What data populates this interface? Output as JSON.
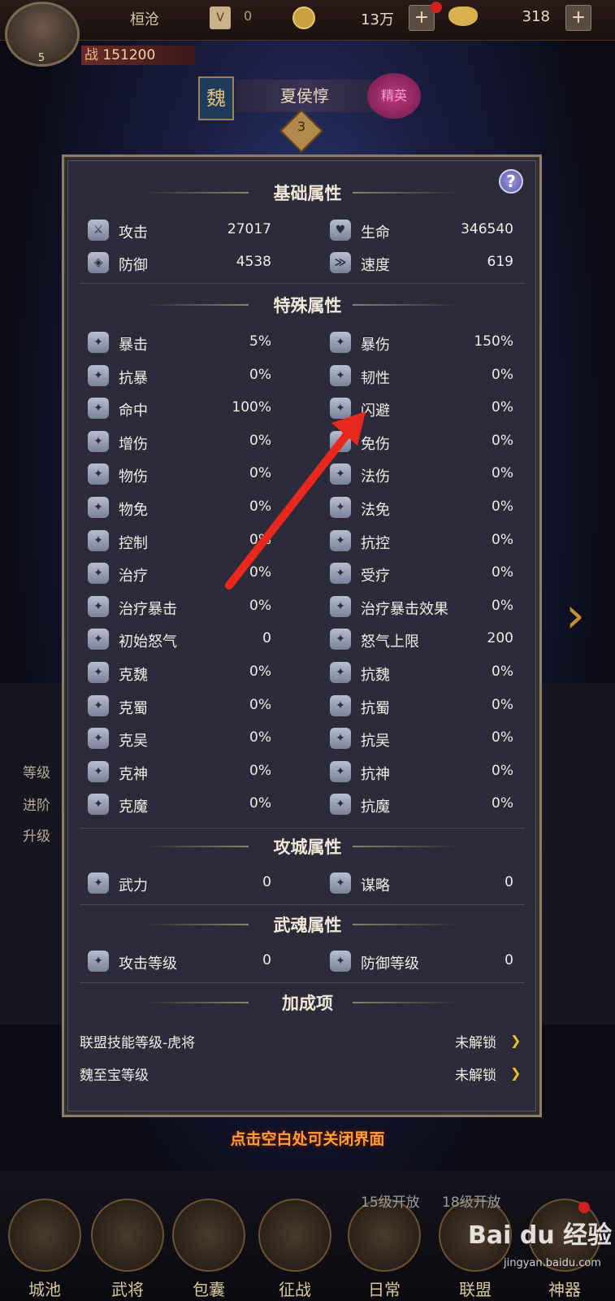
{
  "topbar": {
    "player_name": "桓沧",
    "vip_label": "V",
    "vip_value": "0",
    "coins": "13万",
    "ingots": "318",
    "plus": "+",
    "avatar_level": "5",
    "power_prefix": "战",
    "power": "151200"
  },
  "hero": {
    "faction": "魏",
    "name": "夏侯惇",
    "badge": "精英",
    "stars": "3"
  },
  "background_labels": {
    "level": "等级",
    "advance": "进阶",
    "upgrade": "升级"
  },
  "panel": {
    "help": "?",
    "sections": {
      "basic": "基础属性",
      "special": "特殊属性",
      "siege": "攻城属性",
      "soul": "武魂属性",
      "bonus": "加成项"
    },
    "basic_stats": [
      {
        "icon": "sword-icon",
        "label": "攻击",
        "value": "27017"
      },
      {
        "icon": "heart-icon",
        "label": "生命",
        "value": "346540"
      },
      {
        "icon": "shield-icon",
        "label": "防御",
        "value": "4538"
      },
      {
        "icon": "speed-icon",
        "label": "速度",
        "value": "619"
      }
    ],
    "special_stats": [
      {
        "icon": "crit-icon",
        "label": "暴击",
        "value": "5%"
      },
      {
        "icon": "crit-damage-icon",
        "label": "暴伤",
        "value": "150%"
      },
      {
        "icon": "anti-crit-icon",
        "label": "抗暴",
        "value": "0%"
      },
      {
        "icon": "toughness-icon",
        "label": "韧性",
        "value": "0%"
      },
      {
        "icon": "accuracy-icon",
        "label": "命中",
        "value": "100%"
      },
      {
        "icon": "dodge-icon",
        "label": "闪避",
        "value": "0%"
      },
      {
        "icon": "damage-boost-icon",
        "label": "增伤",
        "value": "0%"
      },
      {
        "icon": "damage-reduce-icon",
        "label": "免伤",
        "value": "0%"
      },
      {
        "icon": "physical-damage-icon",
        "label": "物伤",
        "value": "0%"
      },
      {
        "icon": "magic-damage-icon",
        "label": "法伤",
        "value": "0%"
      },
      {
        "icon": "physical-immune-icon",
        "label": "物免",
        "value": "0%"
      },
      {
        "icon": "magic-immune-icon",
        "label": "法免",
        "value": "0%"
      },
      {
        "icon": "control-icon",
        "label": "控制",
        "value": "0%"
      },
      {
        "icon": "anti-control-icon",
        "label": "抗控",
        "value": "0%"
      },
      {
        "icon": "heal-icon",
        "label": "治疗",
        "value": "0%"
      },
      {
        "icon": "heal-received-icon",
        "label": "受疗",
        "value": "0%"
      },
      {
        "icon": "heal-crit-icon",
        "label": "治疗暴击",
        "value": "0%"
      },
      {
        "icon": "heal-crit-effect-icon",
        "label": "治疗暴击效果",
        "value": "0%"
      },
      {
        "icon": "initial-rage-icon",
        "label": "初始怒气",
        "value": "0"
      },
      {
        "icon": "rage-cap-icon",
        "label": "怒气上限",
        "value": "200"
      },
      {
        "icon": "counter-wei-icon",
        "label": "克魏",
        "value": "0%"
      },
      {
        "icon": "resist-wei-icon",
        "label": "抗魏",
        "value": "0%"
      },
      {
        "icon": "counter-shu-icon",
        "label": "克蜀",
        "value": "0%"
      },
      {
        "icon": "resist-shu-icon",
        "label": "抗蜀",
        "value": "0%"
      },
      {
        "icon": "counter-wu-icon",
        "label": "克吴",
        "value": "0%"
      },
      {
        "icon": "resist-wu-icon",
        "label": "抗吴",
        "value": "0%"
      },
      {
        "icon": "counter-god-icon",
        "label": "克神",
        "value": "0%"
      },
      {
        "icon": "resist-god-icon",
        "label": "抗神",
        "value": "0%"
      },
      {
        "icon": "counter-demon-icon",
        "label": "克魔",
        "value": "0%"
      },
      {
        "icon": "resist-demon-icon",
        "label": "抗魔",
        "value": "0%"
      }
    ],
    "siege_stats": [
      {
        "icon": "force-icon",
        "label": "武力",
        "value": "0"
      },
      {
        "icon": "strategy-icon",
        "label": "谋略",
        "value": "0"
      }
    ],
    "soul_stats": [
      {
        "icon": "attack-level-icon",
        "label": "攻击等级",
        "value": "0"
      },
      {
        "icon": "defense-level-icon",
        "label": "防御等级",
        "value": "0"
      }
    ],
    "bonus_items": [
      {
        "label": "联盟技能等级-虎将",
        "value": "未解锁"
      },
      {
        "label": "魏至宝等级",
        "value": "未解锁"
      }
    ]
  },
  "close_hint": "点击空白处可关闭界面",
  "nav": {
    "items": [
      "城池",
      "武将",
      "包囊",
      "征战",
      "日常",
      "联盟",
      "神器"
    ],
    "locked": [
      "15级开放",
      "18级开放"
    ]
  },
  "watermark": {
    "brand": "Bai du 经验",
    "url": "jingyan.baidu.com"
  },
  "colors": {
    "panel_bg": "#2c2b3a",
    "panel_border": "#8a7d6a",
    "hint_orange": "#ff9e3a",
    "annotation_red": "#e8281e",
    "bonus_arrow": "#f0c020"
  }
}
